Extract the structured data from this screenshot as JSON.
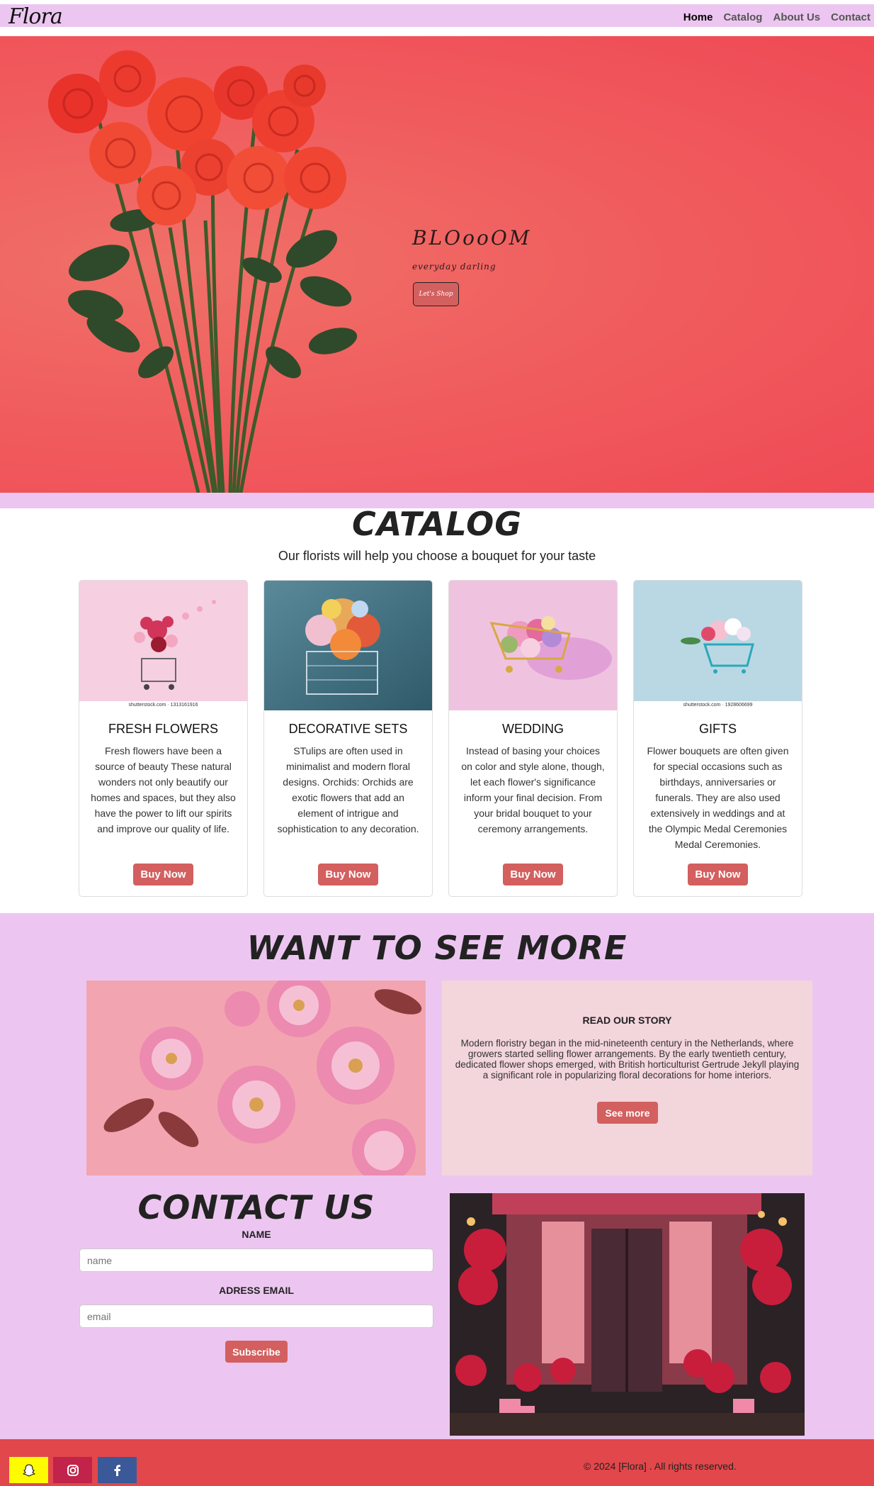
{
  "navbar": {
    "brand": "Flora",
    "links": [
      "Home",
      "Catalog",
      "About Us",
      "Contact"
    ]
  },
  "hero": {
    "title": "BLOooOM",
    "subtitle": "everyday darling",
    "button": "Let's Shop"
  },
  "catalog": {
    "title": "CATALOG",
    "subtitle": "Our florists will help you choose a bouquet for your taste",
    "cards": [
      {
        "title": "FRESH FLOWERS",
        "caption": "shutterstock.com · 1313161916",
        "text": "Fresh flowers have been a source of beauty These natural wonders not only beautify our homes and spaces, but they also have the power to lift our spirits and improve our quality of life.",
        "button": "Buy Now"
      },
      {
        "title": "DECORATIVE SETS",
        "caption": "",
        "text": "STulips are often used in minimalist and modern floral designs. Orchids: Orchids are exotic flowers that add an element of intrigue and sophistication to any decoration.",
        "button": "Buy Now"
      },
      {
        "title": "WEDDING",
        "caption": "",
        "text": "Instead of basing your choices on color and style alone, though, let each flower's significance inform your final decision. From your bridal bouquet to your ceremony arrangements.",
        "button": "Buy Now"
      },
      {
        "title": "GIFTS",
        "caption": "shutterstock.com · 1928606699",
        "text": "Flower bouquets are often given for special occasions such as birthdays, anniversaries or funerals. They are also used extensively in weddings and at the Olympic Medal Ceremonies Medal Ceremonies.",
        "button": "Buy Now"
      }
    ]
  },
  "more": {
    "title": "WANT TO SEE MORE",
    "story_title": "READ OUR STORY",
    "story_text": "Modern floristry began in the mid-nineteenth century in the Netherlands, where growers started selling flower arrangements. By the early twentieth century, dedicated flower shops emerged, with British horticulturist Gertrude Jekyll playing a significant role in popularizing floral decorations for home interiors.",
    "button": "See more"
  },
  "contact": {
    "title": "CONTACT US",
    "name_label": "NAME",
    "name_placeholder": "name",
    "email_label": "ADRESS EMAIL",
    "email_placeholder": "email",
    "button": "Subscribe"
  },
  "footer": {
    "copyright": "© 2024 [Flora] . All rights reserved.",
    "social": [
      {
        "icon": "snapchat-icon",
        "color": "#fffc00"
      },
      {
        "icon": "instagram-icon",
        "color": "#c1234a"
      },
      {
        "icon": "facebook-icon",
        "color": "#3b5998"
      }
    ]
  },
  "colors": {
    "accent": "#d35f5f",
    "lavender": "#ecc6f0",
    "footer": "#e2474b",
    "hero": "#f06060"
  }
}
